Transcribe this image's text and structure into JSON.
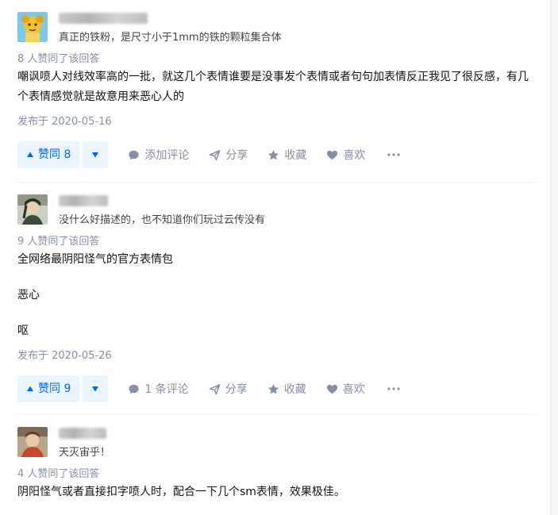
{
  "answers": [
    {
      "headline": "真正的铁粉，是尺寸小于1mm的铁的颗粒集合体",
      "votes_text": "8 人赞同了该回答",
      "content": [
        "嘲讽喷人对线效率高的一批，就这几个表情谁要是没事发个表情或者句句加表情反正我见了很反感，有几个表情感觉就是故意用来恶心人的"
      ],
      "date": "发布于 2020-05-16",
      "vote_label": "赞同 8",
      "comment_label": "添加评论",
      "share_label": "分享",
      "favorite_label": "收藏",
      "like_label": "喜欢"
    },
    {
      "headline": "没什么好描述的，也不知道你们玩过云传没有",
      "votes_text": "9 人赞同了该回答",
      "content": [
        "全网络最阴阳怪气的官方表情包",
        "恶心",
        "呕"
      ],
      "date": "发布于 2020-05-26",
      "vote_label": "赞同 9",
      "comment_label": "1 条评论",
      "share_label": "分享",
      "favorite_label": "收藏",
      "like_label": "喜欢"
    },
    {
      "headline": "天灭宙乎！",
      "votes_text": "4 人赞同了该回答",
      "content": [
        "阴阳怪气或者直接扣字喷人时，配合一下几个sm表情，效果极佳。"
      ]
    }
  ],
  "colors": {
    "accent": "#0066ff",
    "accent_bg": "#ebf5ff",
    "muted": "#8590a6"
  },
  "icons": [
    "triangle-up-icon",
    "triangle-down-icon",
    "comment-icon",
    "share-icon",
    "star-icon",
    "heart-icon",
    "more-icon"
  ]
}
